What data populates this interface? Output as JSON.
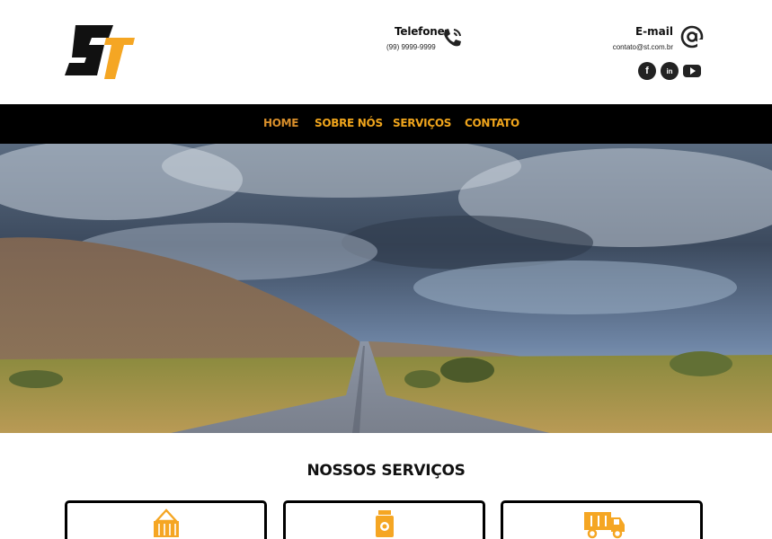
{
  "header": {
    "logo_alt": "ST",
    "phone": {
      "title": "Telefone",
      "number": "(99) 9999-9999",
      "icon": "phone-icon"
    },
    "email": {
      "title": "E-mail",
      "address": "contato@st.com.br",
      "icon": "at-icon"
    },
    "social": [
      {
        "name": "facebook-icon",
        "glyph": "f"
      },
      {
        "name": "linkedin-icon",
        "glyph": "in"
      },
      {
        "name": "youtube-icon",
        "glyph": ""
      }
    ]
  },
  "nav": {
    "items": [
      {
        "label": "HOME",
        "active": true
      },
      {
        "label": "SOBRE NÓS"
      },
      {
        "label": "SERVIÇOS"
      },
      {
        "label": "CONTATO"
      }
    ]
  },
  "hero": {
    "image": "road-under-stormy-sky"
  },
  "services": {
    "title": "NOSSOS SERVIÇOS",
    "cards": [
      {
        "icon": "container-crane-icon"
      },
      {
        "icon": "fuel-canister-icon"
      },
      {
        "icon": "truck-icon"
      }
    ]
  },
  "colors": {
    "accent": "#f5a623",
    "nav_bg": "#000000",
    "text": "#111111"
  }
}
